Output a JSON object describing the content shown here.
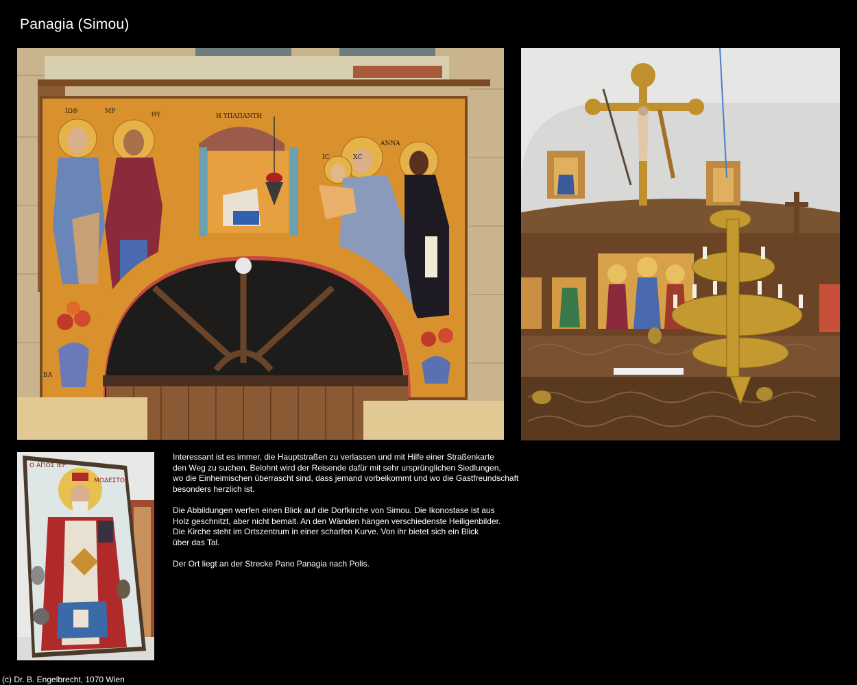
{
  "page": {
    "title": "Panagia (Simou)",
    "footer": "(c) Dr. B. Engelbrecht, 1070 Wien"
  },
  "photos": {
    "fresco": {
      "inscriptions": [
        "ΙΩΦ",
        "ΜΡ",
        "ΘΥ",
        "Η ΥΠΑΠΑΝΤΗ",
        "ΙC",
        "ΧC",
        "ΑΝΝΑ",
        "ΒΑ"
      ]
    },
    "icon": {
      "caption_left": "Ο ΑΓΙΟΣ ΙΕΡ",
      "caption_right": "ΜΟΔΕΣΤΟΣ"
    }
  },
  "text": {
    "paragraphs": [
      [
        "Interessant ist es immer, die Hauptstraßen zu verlassen und mit Hilfe einer Straßenkarte",
        "den Weg zu suchen. Belohnt wird der Reisende dafür mit sehr ursprünglichen Siedlungen,",
        "wo die Einheimischen überrascht sind, dass jemand vorbeikommt und wo die Gastfreundschaft",
        "besonders herzlich ist."
      ],
      [
        "Die Abbildungen werfen einen Blick auf die Dorfkirche von Simou. Die Ikonostase ist aus",
        "Holz geschnitzt, aber nicht bemalt. An den Wänden hängen verschiedenste Heiligenbilder.",
        "Die Kirche steht im Ortszentrum in einer scharfen Kurve. Von ihr bietet sich ein Blick",
        "über das Tal."
      ],
      [
        "Der Ort liegt an der Strecke Pano Panagia nach Polis."
      ]
    ]
  }
}
